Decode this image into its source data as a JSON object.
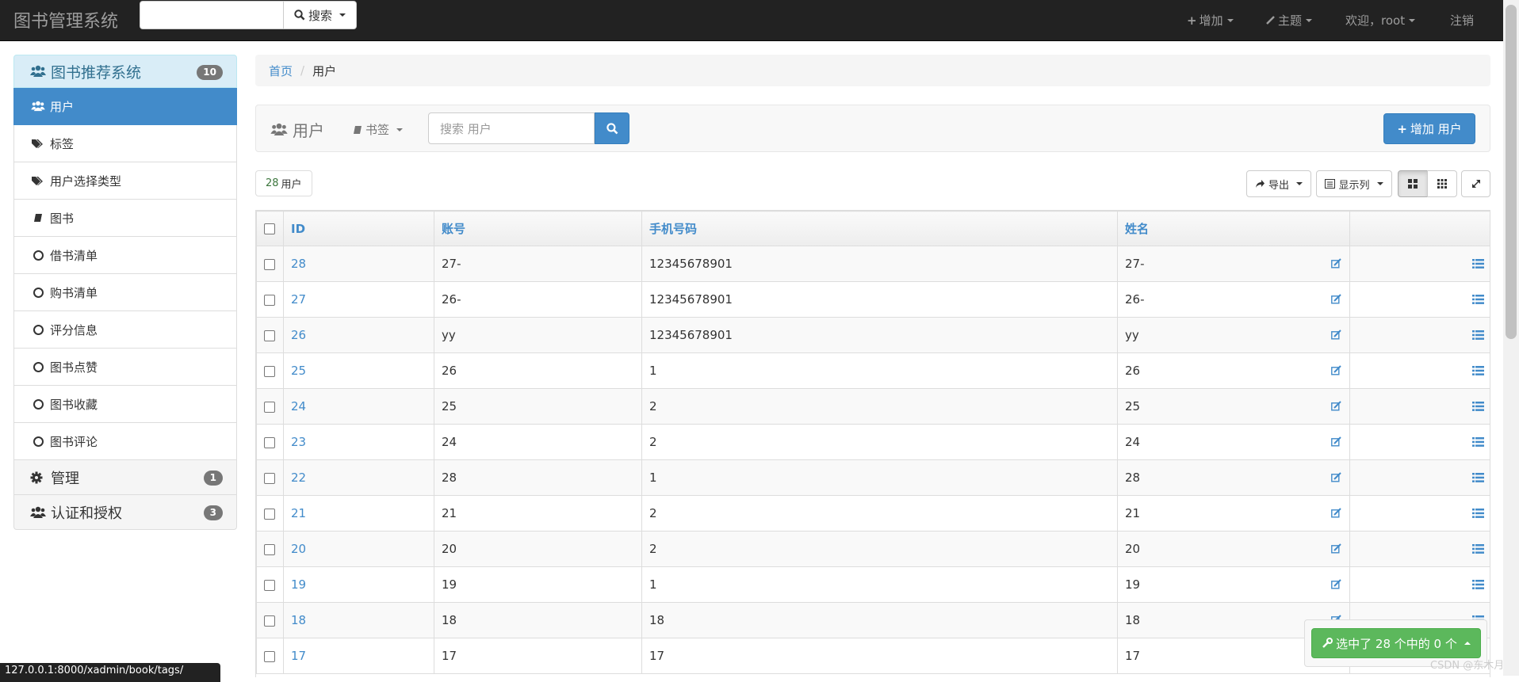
{
  "navbar": {
    "brand": "图书管理系统",
    "search_button": "搜索",
    "add": "增加",
    "theme": "主题",
    "welcome": "欢迎，",
    "user": "root",
    "logout": "注销"
  },
  "sidebar": {
    "head": {
      "label": "图书推荐系统",
      "badge": "10"
    },
    "items": [
      {
        "label": "用户",
        "icon": "users-icon",
        "active": true
      },
      {
        "label": "标签",
        "icon": "tags-icon"
      },
      {
        "label": "用户选择类型",
        "icon": "tags-icon"
      },
      {
        "label": "图书",
        "icon": "book-icon"
      },
      {
        "label": "借书清单",
        "icon": "circle-icon"
      },
      {
        "label": "购书清单",
        "icon": "circle-icon"
      },
      {
        "label": "评分信息",
        "icon": "circle-icon"
      },
      {
        "label": "图书点赞",
        "icon": "circle-icon"
      },
      {
        "label": "图书收藏",
        "icon": "circle-icon"
      },
      {
        "label": "图书评论",
        "icon": "circle-icon"
      }
    ],
    "groups": [
      {
        "label": "管理",
        "badge": "1",
        "icon": "gear-icon"
      },
      {
        "label": "认证和授权",
        "badge": "3",
        "icon": "users-icon"
      }
    ]
  },
  "breadcrumb": {
    "home": "首页",
    "current": "用户"
  },
  "toolbar": {
    "title": "用户",
    "bookmark": "书签",
    "search_placeholder": "搜索 用户",
    "add_button": "增加 用户"
  },
  "summary": {
    "count": "28",
    "unit": "用户"
  },
  "buttons": {
    "export": "导出",
    "columns": "显示列"
  },
  "table": {
    "headers": [
      "ID",
      "账号",
      "手机号码",
      "姓名"
    ],
    "rows": [
      [
        "28",
        "27-",
        "12345678901",
        "27-"
      ],
      [
        "27",
        "26-",
        "12345678901",
        "26-"
      ],
      [
        "26",
        "yy",
        "12345678901",
        "yy"
      ],
      [
        "25",
        "26",
        "1",
        "26"
      ],
      [
        "24",
        "25",
        "2",
        "25"
      ],
      [
        "23",
        "24",
        "2",
        "24"
      ],
      [
        "22",
        "28",
        "1",
        "28"
      ],
      [
        "21",
        "21",
        "2",
        "21"
      ],
      [
        "20",
        "20",
        "2",
        "20"
      ],
      [
        "19",
        "19",
        "1",
        "19"
      ],
      [
        "18",
        "18",
        "18",
        "18"
      ],
      [
        "17",
        "17",
        "17",
        "17"
      ]
    ]
  },
  "status_url": "127.0.0.1:8000/xadmin/book/tags/",
  "selection": "选中了 28 个中的 0 个",
  "watermark": "CSDN @东木月",
  "colors": {
    "primary": "#428bca",
    "success": "#5cb85c",
    "navbar": "#222222"
  }
}
